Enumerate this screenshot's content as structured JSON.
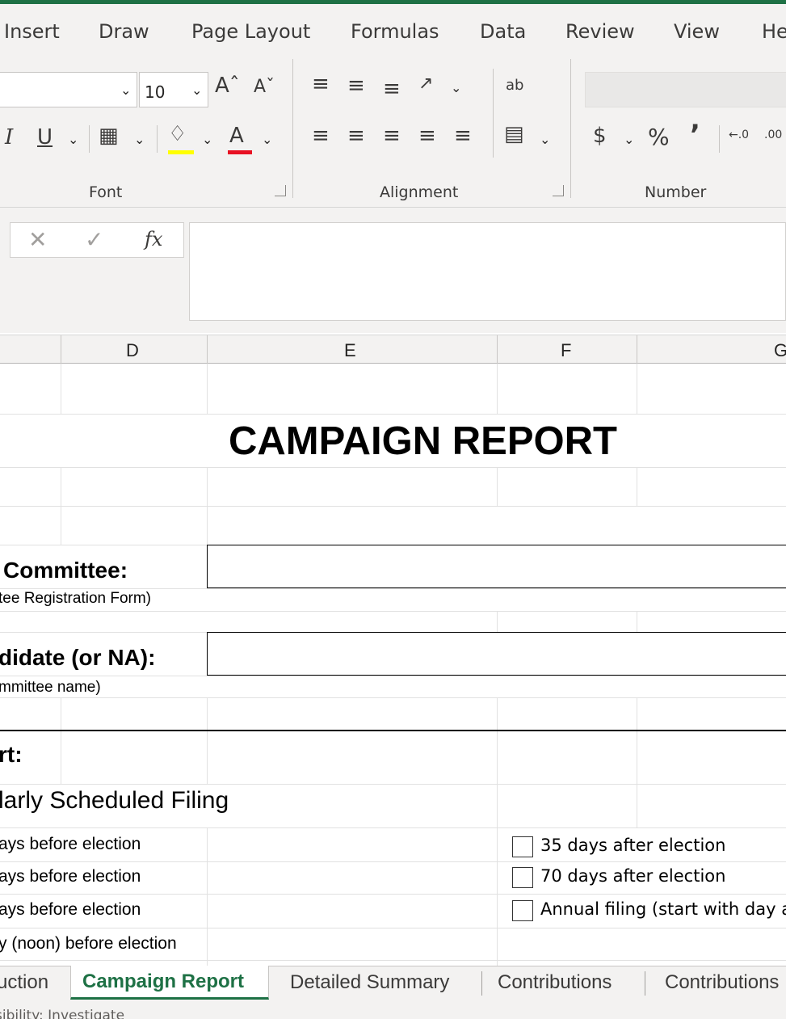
{
  "ribbon_tabs": [
    "Insert",
    "Draw",
    "Page Layout",
    "Formulas",
    "Data",
    "Review",
    "View",
    "He"
  ],
  "font": {
    "size": "10",
    "grow_label": "Aˆ",
    "shrink_label": "Aˇ",
    "italic": "I",
    "underline": "U",
    "font_color_label": "A",
    "group_label": "Font"
  },
  "alignment": {
    "group_label": "Alignment",
    "wrap_label": "ab"
  },
  "number": {
    "group_label": "Number",
    "currency": "$",
    "percent": "%",
    "comma": "’",
    "format_value": ""
  },
  "formula_bar": {
    "cancel": "✕",
    "enter": "✓",
    "fx": "fx",
    "value": ""
  },
  "columns": [
    "D",
    "E",
    "F",
    "G"
  ],
  "sheet": {
    "title": "CAMPAIGN REPORT",
    "committee_label": "Committee:",
    "committee_note": "tee Registration Form)",
    "committee_value": "",
    "candidate_label": "didate (or NA):",
    "candidate_note": "mmittee name)",
    "candidate_value": "",
    "report_label": "rt:",
    "regular_filing": "larly Scheduled Filing",
    "left_options": [
      "ays before election",
      "ays before election",
      "ays before election",
      "y (noon) before election"
    ],
    "right_options": [
      {
        "label": "35 days after election",
        "checked": false
      },
      {
        "label": "70 days after election",
        "checked": false
      },
      {
        "label": "Annual filing (start with day after",
        "checked": false
      }
    ]
  },
  "sheet_tabs": [
    {
      "label": "uction",
      "active": false
    },
    {
      "label": "Campaign Report",
      "active": true
    },
    {
      "label": "Detailed Summary",
      "active": false
    },
    {
      "label": "Contributions",
      "active": false
    },
    {
      "label": "Contributions",
      "active": false
    }
  ],
  "status_bar": {
    "text": "sibility: Investigate"
  },
  "colors": {
    "accent": "#1e7145",
    "ribbon_bg": "#f3f2f1",
    "grid_line": "#e1e1e1"
  }
}
